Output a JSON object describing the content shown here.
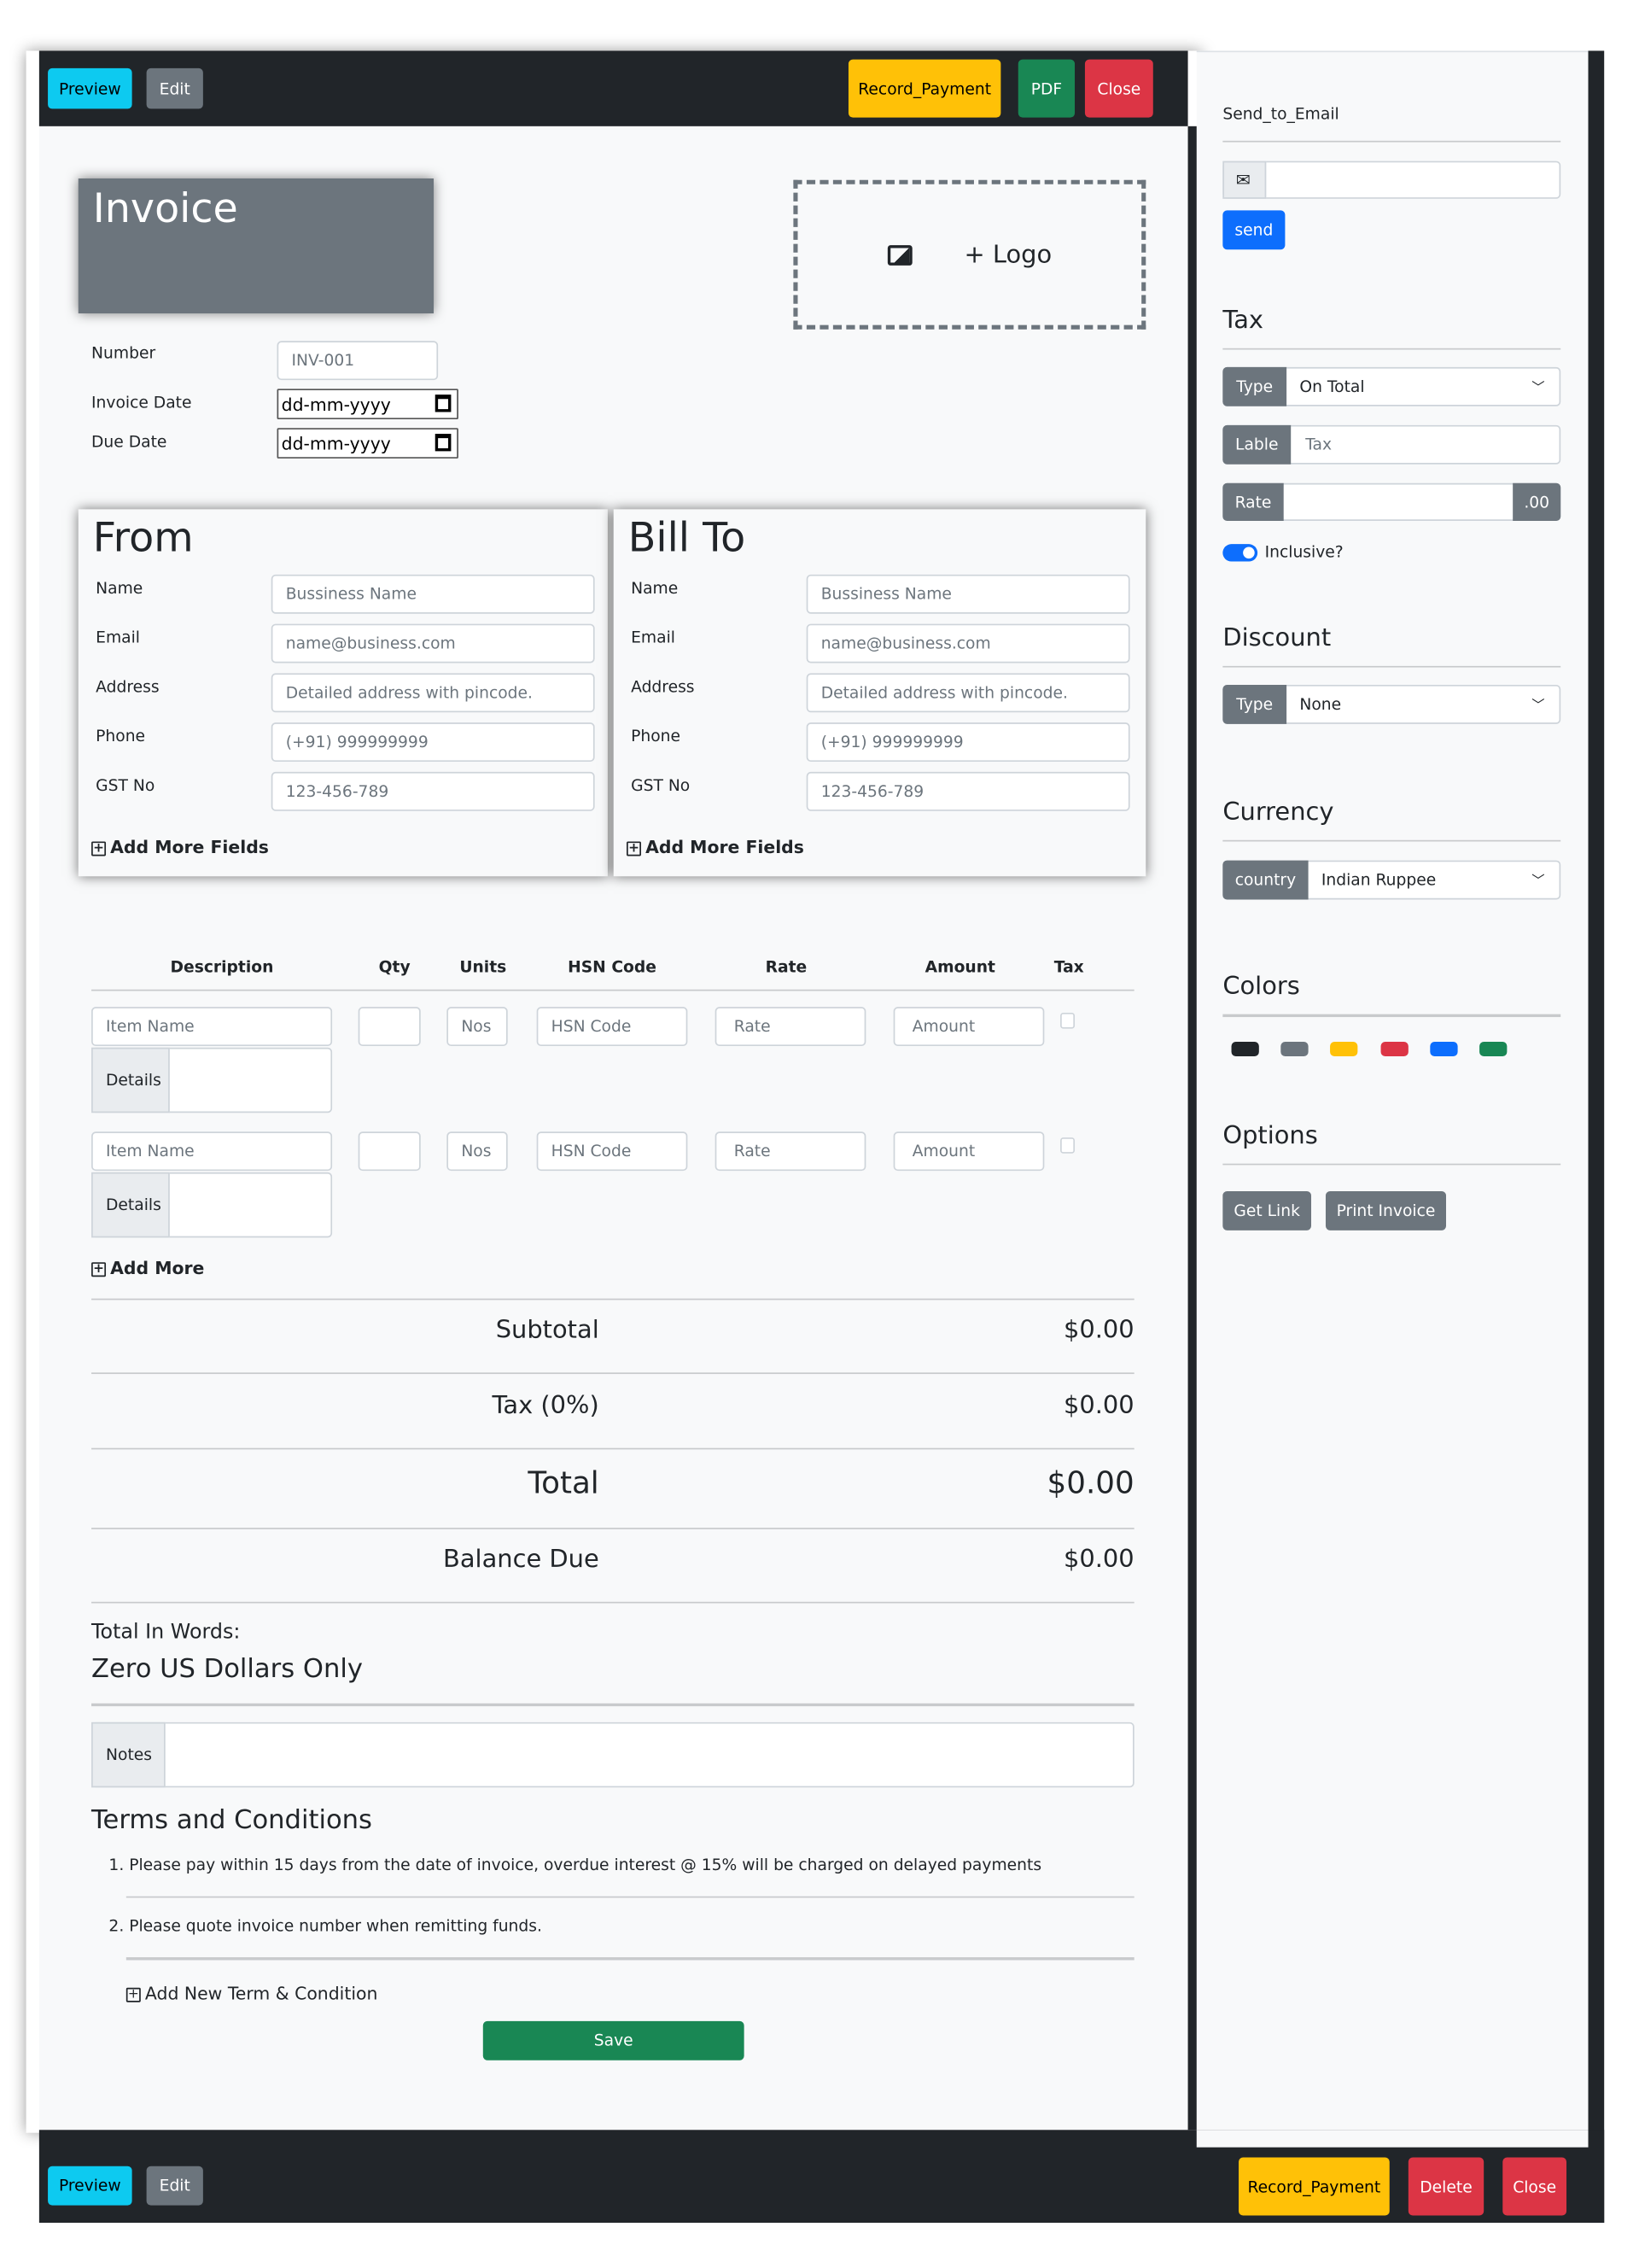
{
  "toolbar": {
    "preview": "Preview",
    "edit": "Edit",
    "record_payment": "Record_Payment",
    "pdf": "PDF",
    "close": "Close"
  },
  "bottom_toolbar": {
    "preview": "Preview",
    "edit": "Edit",
    "record_payment": "Record_Payment",
    "delete": "Delete",
    "close": "Close"
  },
  "invoice": {
    "title": "Invoice",
    "logo_label": "+ Logo",
    "number_label": "Number",
    "number_value": "INV-001",
    "invoice_date_label": "Invoice Date",
    "invoice_date_value": "dd-mm-yyyy",
    "due_date_label": "Due Date",
    "due_date_value": "dd-mm-yyyy"
  },
  "from": {
    "title": "From",
    "fields": [
      {
        "label": "Name",
        "placeholder": "Bussiness Name"
      },
      {
        "label": "Email",
        "placeholder": "name@business.com"
      },
      {
        "label": "Address",
        "placeholder": "Detailed address with pincode."
      },
      {
        "label": "Phone",
        "placeholder": "(+91)  999999999"
      },
      {
        "label": "GST No",
        "placeholder": "123-456-789"
      }
    ],
    "add_more": "Add More Fields"
  },
  "bill_to": {
    "title": "Bill To",
    "fields": [
      {
        "label": "Name",
        "placeholder": "Bussiness Name"
      },
      {
        "label": "Email",
        "placeholder": "name@business.com"
      },
      {
        "label": "Address",
        "placeholder": "Detailed address with pincode."
      },
      {
        "label": "Phone",
        "placeholder": "(+91)  999999999"
      },
      {
        "label": "GST No",
        "placeholder": "123-456-789"
      }
    ],
    "add_more": "Add More Fields"
  },
  "items": {
    "headers": [
      "Description",
      "Qty",
      "Units",
      "HSN Code",
      "Rate",
      "Amount",
      "Tax"
    ],
    "rows": [
      {
        "item_name": "Item Name",
        "units": "Nos",
        "hsn": "HSN Code",
        "rate": "Rate",
        "amount": "Amount",
        "details": "Details"
      },
      {
        "item_name": "Item Name",
        "units": "Nos",
        "hsn": "HSN Code",
        "rate": "Rate",
        "amount": "Amount",
        "details": "Details"
      }
    ],
    "add_more": "Add More"
  },
  "totals": {
    "subtotal_label": "Subtotal",
    "subtotal": "$0.00",
    "tax_label": "Tax (0%)",
    "tax": "$0.00",
    "total_label": "Total",
    "total": "$0.00",
    "balance_label": "Balance Due",
    "balance": "$0.00"
  },
  "words": {
    "label": "Total In Words:",
    "value": "Zero US Dollars Only"
  },
  "notes": {
    "label": "Notes"
  },
  "terms": {
    "title": "Terms and Conditions",
    "items": [
      "1. Please pay within 15 days from the date of invoice, overdue interest @ 15% will be charged on delayed payments",
      "2. Please quote invoice number when remitting funds."
    ],
    "add": "Add New Term & Condition"
  },
  "save": "Save",
  "sidebar": {
    "email": {
      "title": "Send_to_Email",
      "send": "send"
    },
    "tax": {
      "title": "Tax",
      "type_label": "Type",
      "type_value": "On Total",
      "label_label": "Lable",
      "label_placeholder": "Tax",
      "rate_label": "Rate",
      "rate_suffix": ".00",
      "inclusive": "Inclusive?",
      "inclusive_on": true
    },
    "discount": {
      "title": "Discount",
      "type_label": "Type",
      "type_value": "None"
    },
    "currency": {
      "title": "Currency",
      "country_label": "country",
      "country_value": "Indian Ruppee"
    },
    "colors": {
      "title": "Colors",
      "swatches": [
        "#212529",
        "#6c757d",
        "#ffc107",
        "#dc3545",
        "#0d6efd",
        "#198754"
      ]
    },
    "options": {
      "title": "Options",
      "get_link": "Get Link",
      "print": "Print Invoice"
    }
  }
}
